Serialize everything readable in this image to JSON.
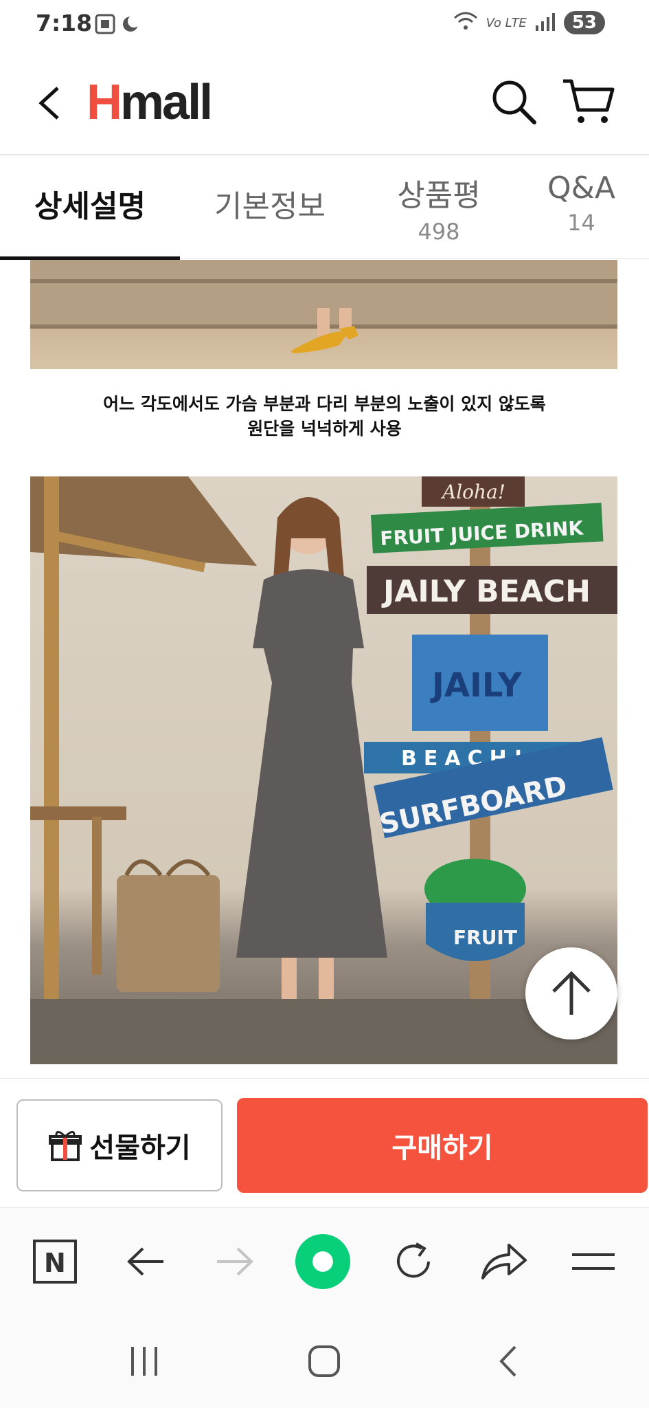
{
  "status_bar": {
    "time": "7:18",
    "network": "Vo LTE",
    "battery": "53"
  },
  "header": {
    "logo_h": "H",
    "logo_rest": "mall"
  },
  "tabs": [
    {
      "label": "상세설명"
    },
    {
      "label": "기본정보"
    },
    {
      "label": "상품평",
      "count": "498"
    },
    {
      "label": "Q&A",
      "count": "14"
    }
  ],
  "content": {
    "caption_line1": "어느 각도에서도 가슴 부분과 다리 부분의 노출이 있지 않도록",
    "caption_line2": "원단을 넉넉하게 사용",
    "signs": [
      "Aloha!",
      "FRUIT JUICE DRINK",
      "JAILY BEACH",
      "JAILY",
      "BEACH!",
      "SURFBOARD",
      "FRUIT"
    ]
  },
  "buy_bar": {
    "gift_label": "선물하기",
    "buy_label": "구매하기"
  },
  "browser_toolbar": {
    "home_letter": "N"
  },
  "colors": {
    "accent": "#f5533d",
    "logo_red": "#f04e3e",
    "naver_green": "#03c75a"
  }
}
